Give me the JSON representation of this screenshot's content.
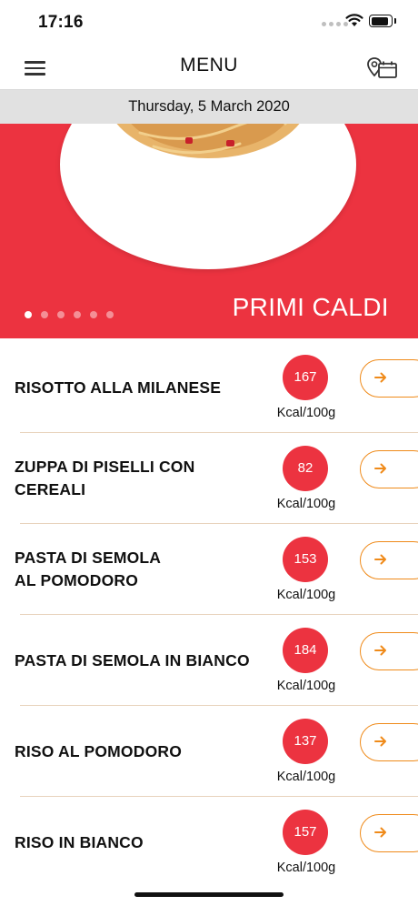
{
  "status_bar": {
    "time": "17:16"
  },
  "nav": {
    "title": "MENU"
  },
  "date": "Thursday, 5 March 2020",
  "hero": {
    "category": "PRIMI CALDI",
    "slides": 6,
    "active_slide": 0
  },
  "colors": {
    "accent_red": "#ec3340",
    "accent_orange": "#ef8a19",
    "date_strip": "#e1e1e1"
  },
  "icons": {
    "menu": "hamburger-icon",
    "location": "location-calendar-icon",
    "arrow": "arrow-right-icon"
  },
  "items": [
    {
      "name": "RISOTTO ALLA MILANESE",
      "kcal": "167",
      "unit": "Kcal/100g"
    },
    {
      "name": "ZUPPA DI PISELLI CON CEREALI",
      "kcal": "82",
      "unit": "Kcal/100g"
    },
    {
      "name": "PASTA DI SEMOLA\nAL POMODORO",
      "kcal": "153",
      "unit": "Kcal/100g"
    },
    {
      "name": "PASTA DI SEMOLA IN BIANCO",
      "kcal": "184",
      "unit": "Kcal/100g"
    },
    {
      "name": "RISO AL POMODORO",
      "kcal": "137",
      "unit": "Kcal/100g"
    },
    {
      "name": "RISO IN BIANCO",
      "kcal": "157",
      "unit": "Kcal/100g"
    }
  ]
}
